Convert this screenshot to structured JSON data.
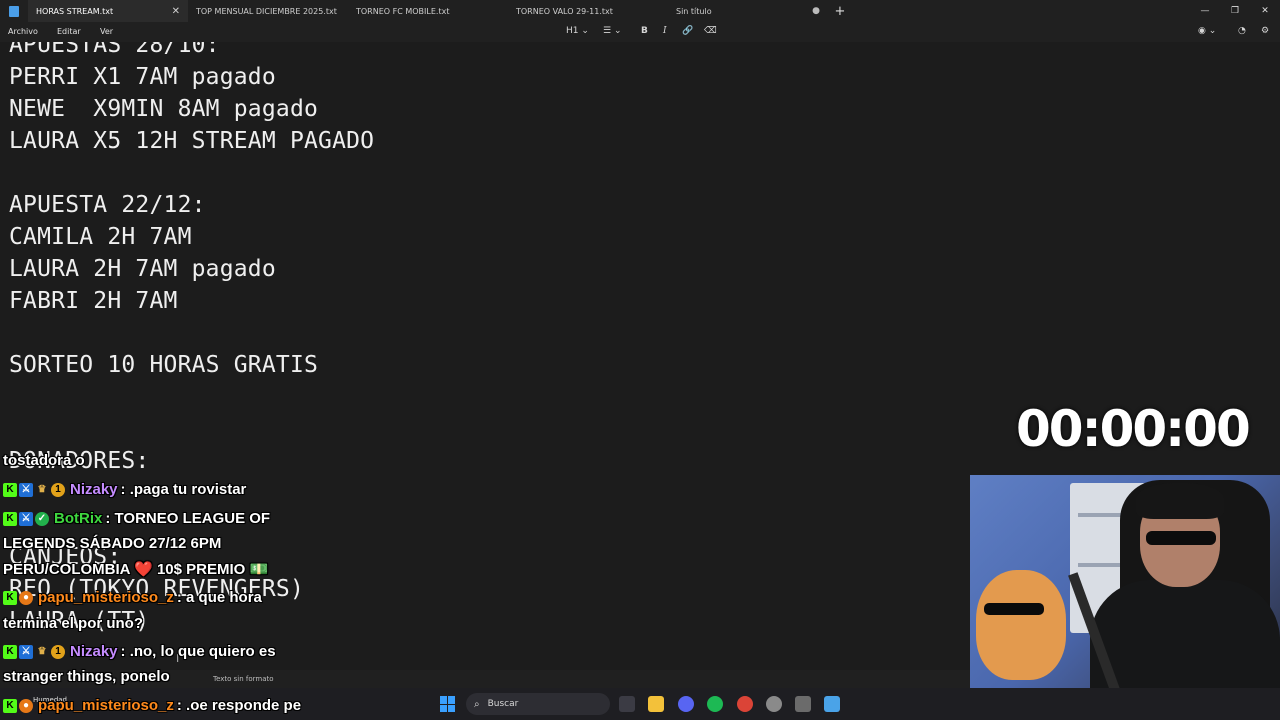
{
  "tabs": [
    {
      "label": "HORAS STREAM.txt",
      "active": true
    },
    {
      "label": "TOP MENSUAL DICIEMBRE 2025.txt"
    },
    {
      "label": "TORNEO FC MOBILE.txt"
    },
    {
      "label": "TORNEO VALO 29-11.txt"
    },
    {
      "label": "Sin título"
    }
  ],
  "menu": {
    "archivo": "Archivo",
    "editar": "Editar",
    "ver": "Ver",
    "heading": "H1"
  },
  "editor_lines": [
    "APUESTAS 28/10:",
    "PERRI X1 7AM pagado",
    "NEWE  X9MIN 8AM pagado",
    "LAURA X5 12H STREAM PAGADO",
    "APUESTA 22/12:",
    "CAMILA 2H 7AM",
    "LAURA 2H 7AM pagado",
    "FABRI 2H 7AM",
    "SORTEO 10 HORAS GRATIS",
    "DONADORES:",
    "CANJEOS:",
    "REO (TOKYO REVENGERS)",
    "LAURA (TT)"
  ],
  "status": {
    "format": "Texto sin formato"
  },
  "timer": "00:00:00",
  "chat": [
    {
      "text": "tostadora o"
    },
    {
      "user": "Nizaky",
      "text": ": .paga tu rovistar",
      "color": "#c58cff"
    },
    {
      "user": "BotRix",
      "text": ": TORNEO LEAGUE OF",
      "color": "#3fd83f"
    },
    {
      "text": "LEGENDS SÁBADO 27/12 6PM"
    },
    {
      "text": "PERU/COLOMBIA ❤️ 10$ PREMIO 💵"
    },
    {
      "user": "papu_misterioso_z",
      "text": ": a que hora",
      "color": "#ff8a1c"
    },
    {
      "text": "termina el por uno?"
    },
    {
      "user": "Nizaky",
      "text": ": .no, lo que quiero es",
      "color": "#c58cff"
    },
    {
      "text": "stranger things, ponelo"
    },
    {
      "user": "papu_misterioso_z",
      "text": ": .oe responde pe",
      "color": "#ff8a1c"
    }
  ],
  "taskbar": {
    "weather": "Humedad",
    "search": "Buscar"
  }
}
